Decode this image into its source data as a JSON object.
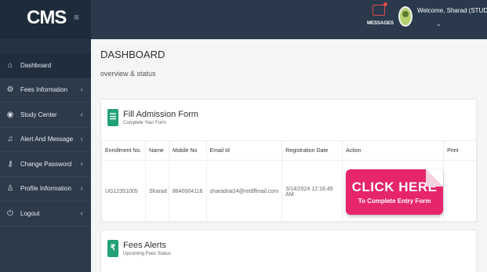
{
  "app": {
    "brand": "CMS",
    "messages_label": "MESSAGES",
    "welcome": "Welcome, Sharad (STUDENT)"
  },
  "sidebar": {
    "items": [
      {
        "label": "Dashboard",
        "icon": "home-icon"
      },
      {
        "label": "Fees Information",
        "icon": "gear-icon"
      },
      {
        "label": "Study Center",
        "icon": "target-icon"
      },
      {
        "label": "Alert And Message",
        "icon": "bell-icon"
      },
      {
        "label": "Change Password",
        "icon": "key-icon"
      },
      {
        "label": "Profile Information",
        "icon": "user-icon"
      },
      {
        "label": "Logout",
        "icon": "power-icon"
      }
    ]
  },
  "main": {
    "title": "DASHBOARD",
    "subtitle": "overview & status",
    "admission": {
      "title": "Fill Admission Form",
      "subtitle": "Complete Your Form",
      "columns": [
        "Enrollment No.",
        "Name",
        "Mobile No",
        "Email Id",
        "Registration Date",
        "Action",
        "Print"
      ],
      "row": {
        "enrollment": "UG12351005",
        "name": "Sharad",
        "mobile": "8840004116",
        "email": "sharadrai24@rediffmail.com",
        "registration_date": "3/14/2024 12:16:45 AM",
        "action_main": "CLICK HERE",
        "action_sub": "To Complete Entry Form",
        "print": ""
      }
    },
    "fees": {
      "title": "Fees Alerts",
      "subtitle": "Upcoming Fees Status",
      "badge": "₹"
    }
  },
  "colors": {
    "topbar": "#2a3a4c",
    "sidebar": "#2c3a4a",
    "accent_green": "#23a176",
    "cta_pink": "#e6256d"
  }
}
